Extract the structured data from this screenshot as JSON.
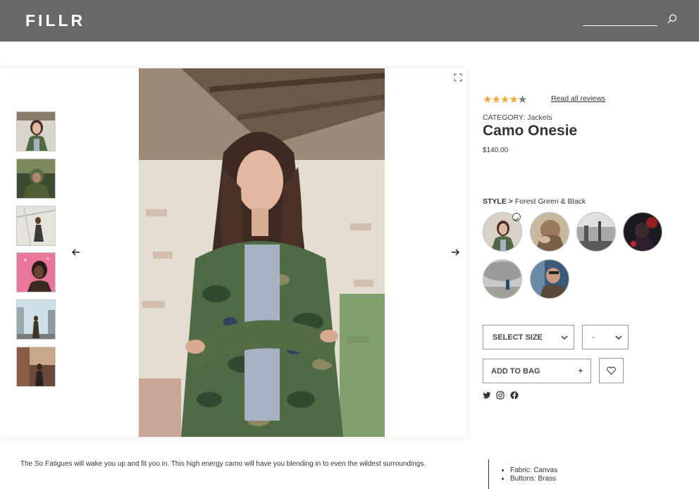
{
  "header": {
    "logo": "FILLR",
    "search_placeholder": ""
  },
  "gallery": {
    "thumbnails": [
      {
        "alt": "woman in camo jacket"
      },
      {
        "alt": "man in green hoodie"
      },
      {
        "alt": "woman on bench"
      },
      {
        "alt": "woman on pink background"
      },
      {
        "alt": "person on city street"
      },
      {
        "alt": "person by brick wall"
      }
    ],
    "prev_icon": "arrow-left-icon",
    "next_icon": "arrow-right-icon",
    "expand_icon": "expand-icon"
  },
  "product": {
    "rating_stars": 4,
    "rating_max": 5,
    "reviews_link": "Read all reviews",
    "category": "CATEGORY: Jackets",
    "title": "Camo Onesie",
    "price": "$140.00",
    "style_label": "STYLE >",
    "style_value": "Forest Green & Black",
    "size_select": "SELECT SIZE",
    "qty_select": "-",
    "add_to_bag": "ADD TO BAG",
    "add_symbol": "+"
  },
  "description": "The So Fatigues will wake you up and fit you in. This high energy camo will have you blending in to even the wildest surroundings.",
  "specs": [
    "Fabric: Canvas",
    "Buttons: Brass"
  ],
  "colors": {
    "header_bg": "#686868",
    "star": "#f0a93b"
  }
}
